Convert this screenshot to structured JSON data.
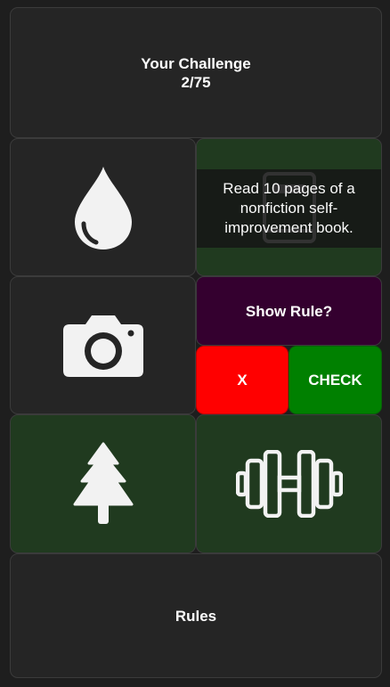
{
  "header": {
    "title": "Your Challenge",
    "progress": "2/75"
  },
  "tiles": {
    "water": {
      "icon": "water-drop-icon"
    },
    "reading": {
      "icon": "book-icon",
      "rule_text": "Read 10 pages of a nonfiction self-improvement book."
    },
    "photo": {
      "icon": "camera-icon"
    },
    "outdoor": {
      "icon": "tree-icon"
    },
    "workout": {
      "icon": "dumbbell-icon"
    }
  },
  "actions": {
    "show_rule_label": "Show Rule?",
    "reject_label": "X",
    "check_label": "CHECK"
  },
  "footer": {
    "rules_label": "Rules"
  },
  "colors": {
    "background": "#1e1e1e",
    "tile_dark": "#252525",
    "tile_green": "#203a1f",
    "show_rule": "#34002f",
    "reject": "#ff0000",
    "check": "#008000"
  }
}
